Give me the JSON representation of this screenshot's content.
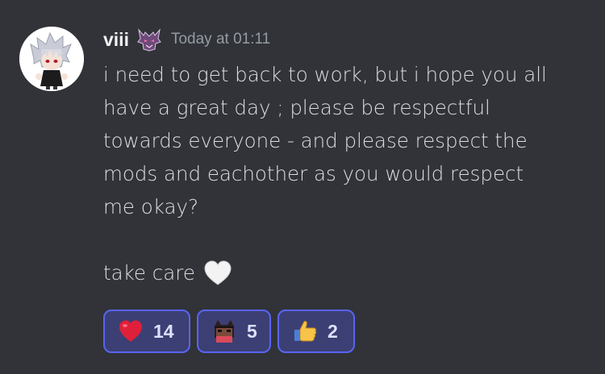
{
  "message": {
    "author": "viii",
    "timestamp": "Today at 01:11",
    "role_icon": "demon-mask-icon",
    "avatar": "anime-avatar-white-hair",
    "content_lines": [
      "i need to get back to work, but i hope you all",
      "have a great day ; please be respectful",
      "towards everyone - and please respect the",
      "mods and eachother as you would respect",
      "me okay?",
      "",
      "take care"
    ],
    "trailing_emoji": "white-heart-icon"
  },
  "reactions": [
    {
      "emoji": "red-heart-icon",
      "count": "14"
    },
    {
      "emoji": "custom-cat-emoji-icon",
      "count": "5"
    },
    {
      "emoji": "thumbs-up-icon",
      "count": "2"
    }
  ],
  "colors": {
    "background": "#313338",
    "text": "#dbdee1",
    "username": "#f2f3f5",
    "timestamp": "#949ba4",
    "reaction_border": "#5865f2",
    "reaction_bg": "#3c3f73"
  }
}
